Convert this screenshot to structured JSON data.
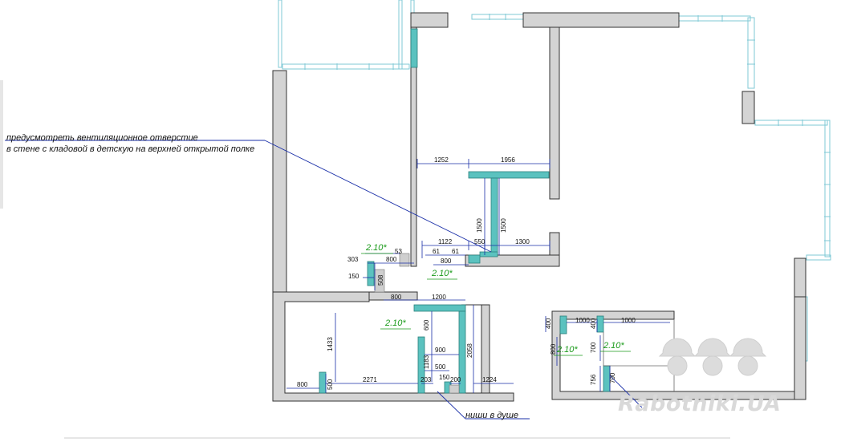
{
  "notes": {
    "ventilation_line1": "предусмотреть вентиляционное отверстие",
    "ventilation_line2": "в стене с кладовой в детскую на верхней открытой полке",
    "shower_niches": "ниши в душе"
  },
  "heights": {
    "h1": "2.10*",
    "h2": "2.10*",
    "h3": "2.10*",
    "h4": "2.10*",
    "h5": "2.10*"
  },
  "dims": {
    "d1252": "1252",
    "d1956": "1956",
    "d1500a": "1500",
    "d1500b": "1500",
    "d1122": "1122",
    "d550": "550",
    "d1300": "1300",
    "d53": "53",
    "d61a": "61",
    "d61b": "61",
    "d303": "303",
    "d800a": "800",
    "d800b": "800",
    "d150a": "150",
    "d508": "508",
    "d800c": "800",
    "d1200": "1200",
    "d600": "600",
    "d1433": "1433",
    "d1183": "1183",
    "d900": "900",
    "d2058": "2058",
    "d500a": "500",
    "d150b": "150",
    "d800d": "800",
    "d500b": "500",
    "d2271": "2271",
    "d203": "203",
    "d200": "200",
    "d1224": "1224",
    "d400a": "400",
    "d1000a": "1000",
    "d400b": "400",
    "d1000b": "1000",
    "d800e": "800",
    "d700a": "700",
    "d756": "756",
    "d700b": "700"
  },
  "watermark": {
    "text": "Rabotniki.UA"
  },
  "colors": {
    "wall": "#d4d4d4",
    "wall_stroke": "#333333",
    "partition": "#5bc2bf",
    "window": "#7fc9d6",
    "dimension": "#1a2fa8",
    "height_label": "#1a9a1a"
  }
}
